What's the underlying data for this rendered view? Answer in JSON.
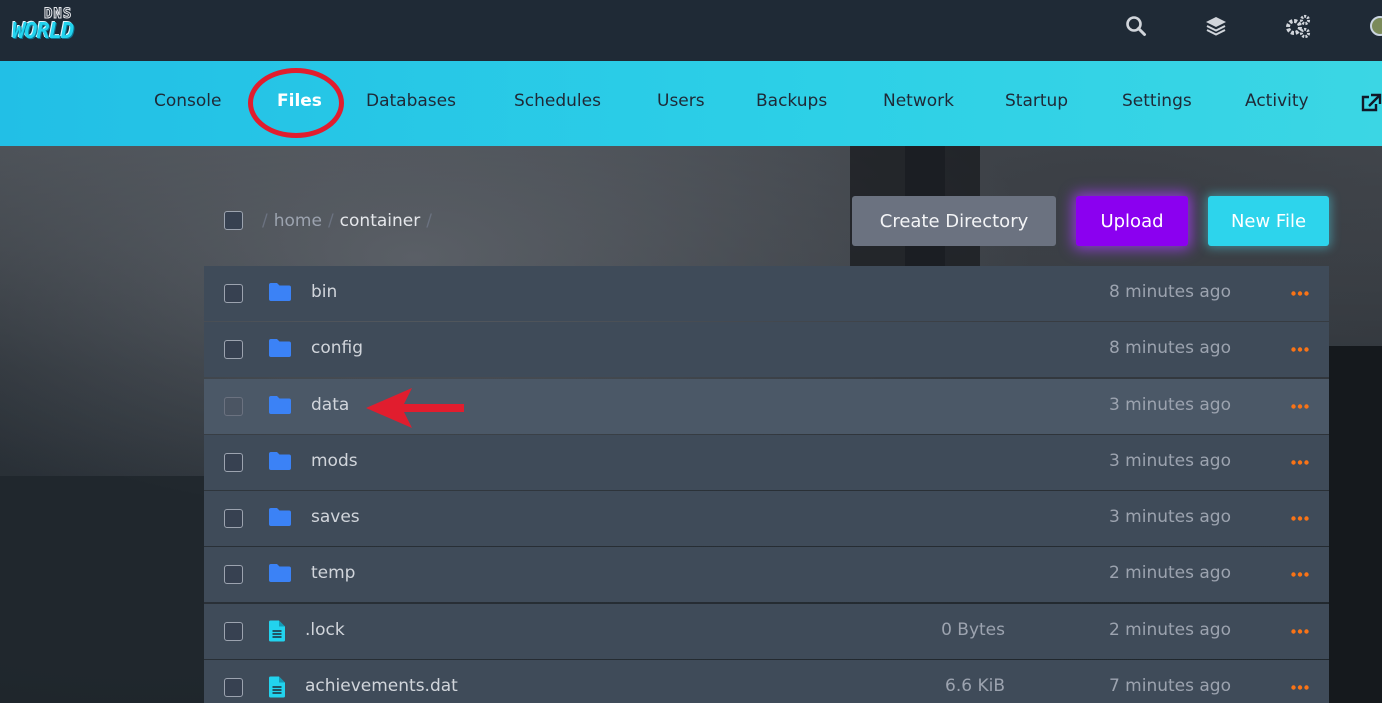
{
  "brand": {
    "logo_top": "DNS",
    "logo_main": "WORLD"
  },
  "topbar": {
    "icons": [
      "search-icon",
      "layers-icon",
      "cogs-icon"
    ]
  },
  "nav": {
    "items": [
      {
        "label": "Console"
      },
      {
        "label": "Files",
        "active": true
      },
      {
        "label": "Databases"
      },
      {
        "label": "Schedules"
      },
      {
        "label": "Users"
      },
      {
        "label": "Backups"
      },
      {
        "label": "Network"
      },
      {
        "label": "Startup"
      },
      {
        "label": "Settings"
      },
      {
        "label": "Activity"
      }
    ]
  },
  "breadcrumb": {
    "sep": "/",
    "parts": [
      "home",
      "container"
    ]
  },
  "actions": {
    "create_directory": "Create Directory",
    "upload": "Upload",
    "new_file": "New File"
  },
  "files": [
    {
      "name": "bin",
      "type": "folder",
      "size": "",
      "modified": "8 minutes ago"
    },
    {
      "name": "config",
      "type": "folder",
      "size": "",
      "modified": "8 minutes ago"
    },
    {
      "name": "data",
      "type": "folder",
      "size": "",
      "modified": "3 minutes ago",
      "highlighted": true
    },
    {
      "name": "mods",
      "type": "folder",
      "size": "",
      "modified": "3 minutes ago"
    },
    {
      "name": "saves",
      "type": "folder",
      "size": "",
      "modified": "3 minutes ago"
    },
    {
      "name": "temp",
      "type": "folder",
      "size": "",
      "modified": "2 minutes ago"
    },
    {
      "name": ".lock",
      "type": "file",
      "size": "0 Bytes",
      "modified": "2 minutes ago"
    },
    {
      "name": "achievements.dat",
      "type": "file",
      "size": "6.6 KiB",
      "modified": "7 minutes ago"
    }
  ],
  "colors": {
    "accent": "#22d3ee",
    "upload": "#8b00f0",
    "folder": "#3b82f6",
    "file": "#22d3ee",
    "more": "#f97316",
    "annotation": "#e11d2e"
  }
}
